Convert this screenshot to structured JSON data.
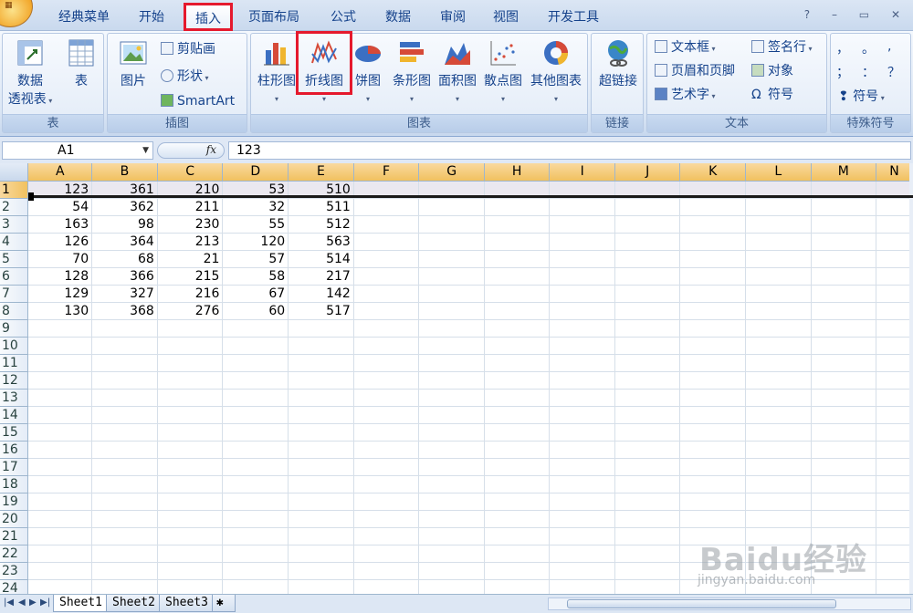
{
  "menu": {
    "office_button_label": "Office",
    "tabs": [
      {
        "label": "经典菜单"
      },
      {
        "label": "开始"
      },
      {
        "label": "插入",
        "active": true
      },
      {
        "label": "页面布局"
      },
      {
        "label": "公式"
      },
      {
        "label": "数据"
      },
      {
        "label": "审阅"
      },
      {
        "label": "视图"
      },
      {
        "label": "开发工具"
      }
    ],
    "help_icon": "?",
    "minimize_icon": "–",
    "restore_icon": "▭",
    "close_icon": "✕"
  },
  "ribbon": {
    "groups": {
      "table": {
        "label": "表",
        "pivot_line1": "数据",
        "pivot_line2": "透视表",
        "table": "表"
      },
      "illustrations": {
        "label": "插图",
        "picture": "图片",
        "clipart": "剪贴画",
        "shapes": "形状",
        "smartart": "SmartArt"
      },
      "charts": {
        "label": "图表",
        "column": "柱形图",
        "line": "折线图",
        "pie": "饼图",
        "bar": "条形图",
        "area": "面积图",
        "scatter": "散点图",
        "other": "其他图表"
      },
      "links": {
        "label": "链接",
        "hyperlink": "超链接"
      },
      "text": {
        "label": "文本",
        "textbox": "文本框",
        "header_footer": "页眉和页脚",
        "wordart": "艺术字",
        "signature": "签名行",
        "object": "对象",
        "symbol": "符号"
      },
      "special": {
        "label": "特殊符号",
        "comma": "，",
        "dot": "。",
        "semicolon": "；",
        "colon": "：",
        "question": "？",
        "symbol": "符号"
      }
    },
    "colors": {
      "highlight": "#e5192d"
    }
  },
  "formula_bar": {
    "name_box": "A1",
    "fx_label": "fx",
    "formula": "123"
  },
  "sheet": {
    "columns": [
      "A",
      "B",
      "C",
      "D",
      "E",
      "F",
      "G",
      "H",
      "I",
      "J",
      "K",
      "L",
      "M",
      "N"
    ],
    "row_count": 24,
    "data": [
      [
        123,
        361,
        210,
        53,
        510
      ],
      [
        54,
        362,
        211,
        32,
        511
      ],
      [
        163,
        98,
        230,
        55,
        512
      ],
      [
        126,
        364,
        213,
        120,
        563
      ],
      [
        70,
        68,
        21,
        57,
        514
      ],
      [
        128,
        366,
        215,
        58,
        217
      ],
      [
        129,
        327,
        216,
        67,
        142
      ],
      [
        130,
        368,
        276,
        60,
        517
      ]
    ]
  },
  "sheet_tabs": [
    "Sheet1",
    "Sheet2",
    "Sheet3"
  ],
  "watermark": {
    "brand": "Baidu经验",
    "url": "jingyan.baidu.com"
  }
}
